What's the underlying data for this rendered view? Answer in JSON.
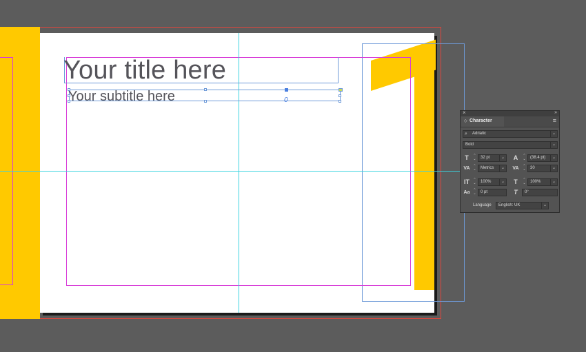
{
  "document": {
    "title_text": "Your title here",
    "subtitle_text": "Your subtitle here",
    "big_number": "1",
    "subtitle_glyph": "0"
  },
  "character_panel": {
    "close_glyph": "×",
    "collapse_glyph": "»",
    "tab_arrow": "◇",
    "tab_label": "Character",
    "menu_glyph": "≡",
    "font_family": "Adriatic",
    "font_style": "Bold",
    "font_size": "32 pt",
    "leading": "(38.4 pt)",
    "kerning": "Metrics",
    "tracking": "30",
    "vertical_scale": "100%",
    "horizontal_scale": "100%",
    "baseline_shift": "0 pt",
    "skew": "0°",
    "language_label": "Language",
    "language": "English: UK",
    "icons": {
      "search": "search-icon",
      "font_size": "font-size-icon",
      "leading": "leading-icon",
      "kerning": "kerning-icon",
      "tracking": "tracking-icon",
      "vertical_scale": "vertical-scale-icon",
      "horizontal_scale": "horizontal-scale-icon",
      "baseline_shift": "baseline-shift-icon",
      "skew": "skew-icon"
    }
  },
  "colors": {
    "accent_yellow": "#ffc900",
    "guide_cyan": "#39d3e0",
    "margin_magenta": "#d83cd8",
    "frame_blue": "#6e9ad8",
    "bleed_red": "#e0463c",
    "text_gray": "#55545a"
  }
}
